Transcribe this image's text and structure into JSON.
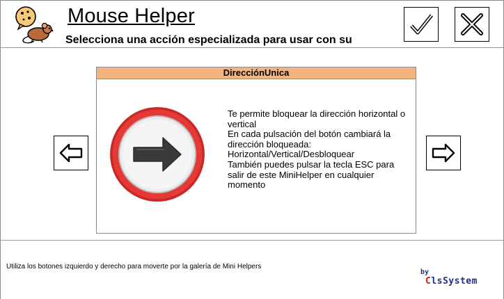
{
  "header": {
    "title": "Mouse Helper",
    "subtitle": "Selecciona una acción especializada para usar con su",
    "ok_icon": "checkmark-icon",
    "close_icon": "close-icon",
    "logo_icon": "mouse-cookie-logo-icon"
  },
  "card": {
    "title": "DirecciónUnica",
    "icon": "right-arrow-sign-icon",
    "description": "Te permite bloquear la dirección horizontal o vertical\nEn cada pulsación del botón cambiará la dirección bloqueada: Horizontal/Vertical/Desbloquear\nTambién puedes pulsar la tecla ESC para salir de este MiniHelper en cualquier momento"
  },
  "nav": {
    "prev_icon": "arrow-left-icon",
    "next_icon": "arrow-right-icon"
  },
  "footer": {
    "hint": "Utiliza los botones izquierdo y derecho para moverte por la galería de Mini Helpers",
    "by": "by",
    "brand_first": "C",
    "brand_rest": "lsSystem"
  },
  "colors": {
    "card_header": "#f4b47e",
    "sign_red": "#e53935",
    "brand_red": "#d41e1e",
    "brand_blue": "#1e2f8e"
  }
}
